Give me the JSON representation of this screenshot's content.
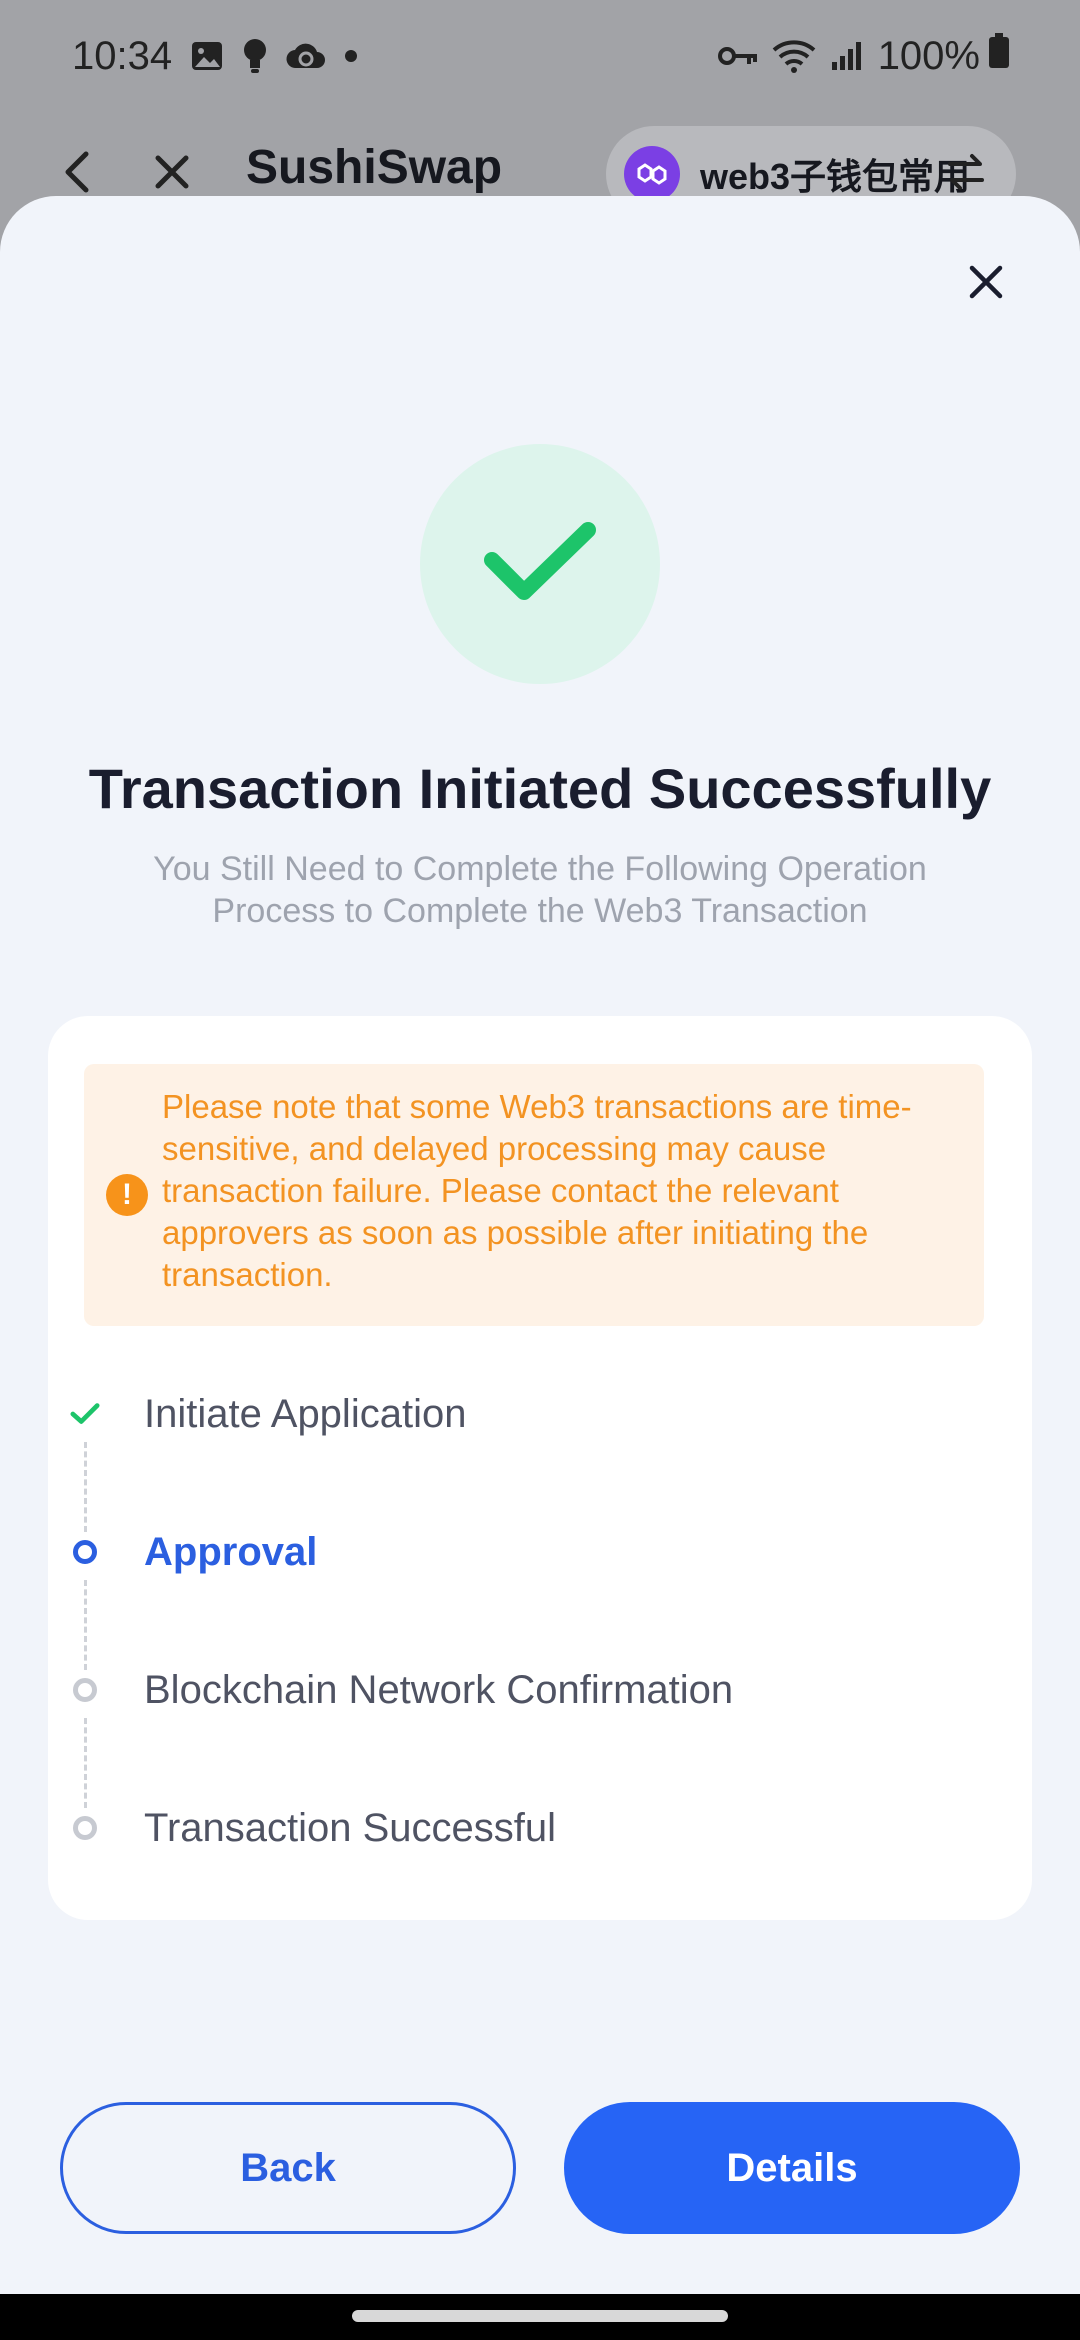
{
  "status_bar": {
    "time": "10:34",
    "battery": "100%",
    "left_icons": [
      "gallery-icon",
      "bulb-icon",
      "cloud-sync-icon",
      "dot-icon"
    ],
    "right_icons": [
      "key-icon",
      "wifi-icon",
      "signal-icon",
      "battery-icon"
    ]
  },
  "header": {
    "title": "SushiSwap",
    "wallet_name": "web3子钱包常用"
  },
  "sheet": {
    "title": "Transaction Initiated Successfully",
    "subtitle": "You Still Need to Complete the Following Operation Process to Complete the Web3 Transaction",
    "notice": "Please note that some Web3 transactions are time-sensitive, and delayed processing may cause transaction failure. Please contact the relevant approvers as soon as possible after initiating the transaction.",
    "steps": [
      {
        "label": "Initiate Application",
        "state": "done"
      },
      {
        "label": "Approval",
        "state": "active"
      },
      {
        "label": "Blockchain Network Confirmation",
        "state": "pending"
      },
      {
        "label": "Transaction Successful",
        "state": "pending"
      }
    ]
  },
  "buttons": {
    "back": "Back",
    "details": "Details"
  },
  "colors": {
    "primary": "#2664f5",
    "success": "#1dc46a",
    "warning": "#f39322",
    "sheet_bg": "#f1f4fa"
  }
}
